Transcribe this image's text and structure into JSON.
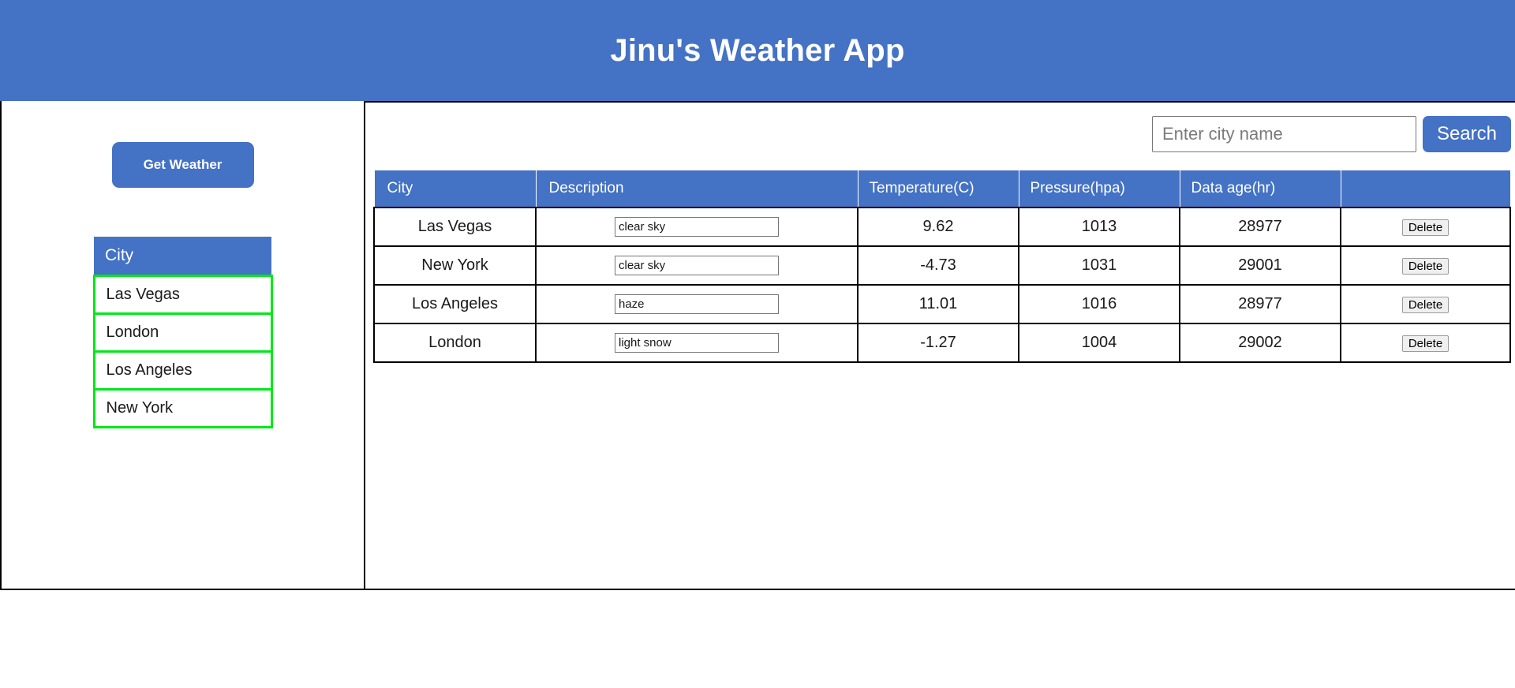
{
  "header": {
    "title": "Jinu's Weather App",
    "background_color": "#4472C4",
    "text_color": "#ffffff"
  },
  "sidebar": {
    "get_weather_label": "Get Weather",
    "city_list": {
      "header": "City",
      "border_color": "#00E818",
      "items": [
        {
          "name": "Las Vegas"
        },
        {
          "name": "London"
        },
        {
          "name": "Los Angeles"
        },
        {
          "name": "New York"
        }
      ]
    }
  },
  "main": {
    "search": {
      "placeholder": "Enter city name",
      "value": "",
      "button_label": "Search"
    },
    "table": {
      "columns": [
        "City",
        "Description",
        "Temperature(C)",
        "Pressure(hpa)",
        "Data age(hr)",
        ""
      ],
      "delete_label": "Delete",
      "rows": [
        {
          "city": "Las Vegas",
          "description": "clear sky",
          "temperature": "9.62",
          "pressure": "1013",
          "data_age": "28977",
          "action": "Delete"
        },
        {
          "city": "New York",
          "description": "clear sky",
          "temperature": "-4.73",
          "pressure": "1031",
          "data_age": "29001",
          "action": "Delete"
        },
        {
          "city": "Los Angeles",
          "description": "haze",
          "temperature": "11.01",
          "pressure": "1016",
          "data_age": "28977",
          "action": "Delete"
        },
        {
          "city": "London",
          "description": "light snow",
          "temperature": "-1.27",
          "pressure": "1004",
          "data_age": "29002",
          "action": "Delete"
        }
      ]
    }
  },
  "colors": {
    "accent_blue": "#4472C4",
    "list_border_green": "#00E818",
    "table_border": "#000000"
  }
}
